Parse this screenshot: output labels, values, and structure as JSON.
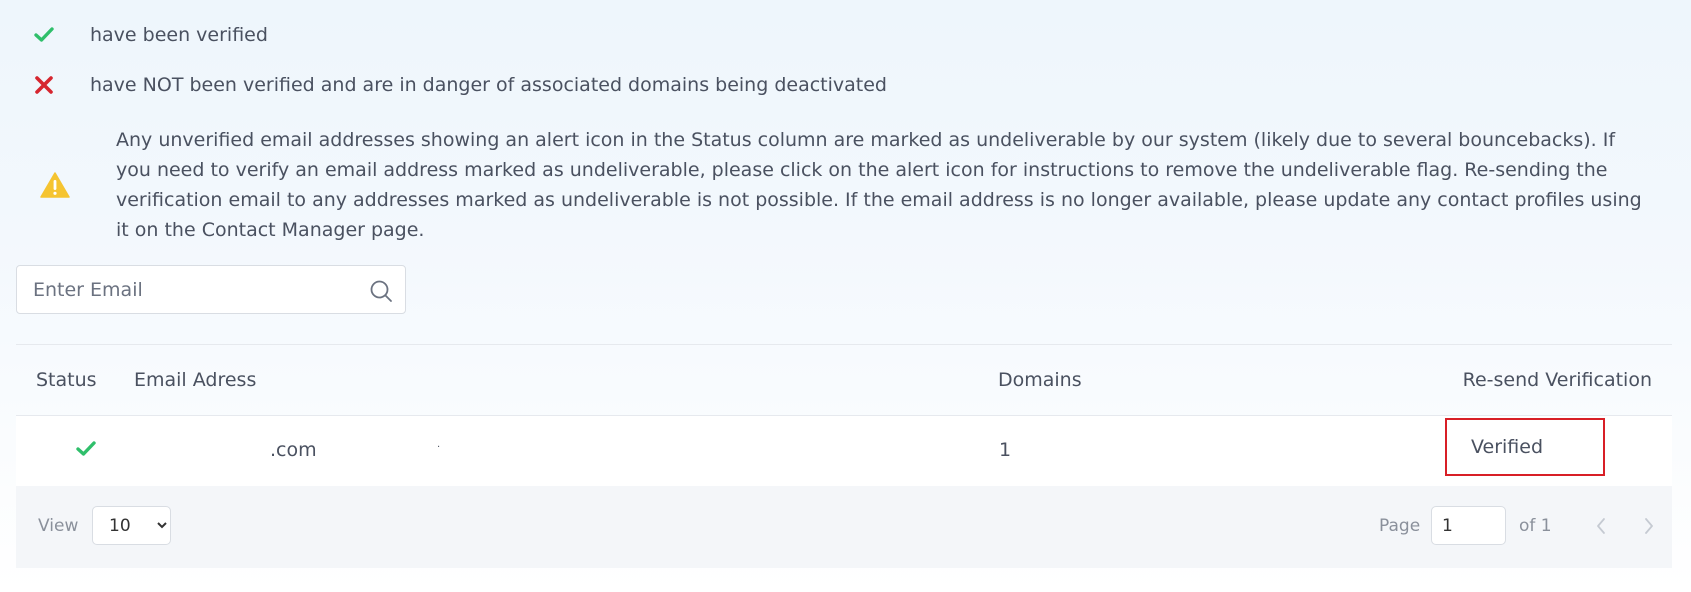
{
  "legend": {
    "verified_text": "have been verified",
    "not_verified_text": "have NOT been verified and are in danger of associated domains being deactivated",
    "warning_text": "Any unverified email addresses showing an alert icon in the Status column are marked as undeliverable by our system (likely due to several bouncebacks). If you need to verify an email address marked as undeliverable, please click on the alert icon for instructions to remove the undeliverable flag. Re-sending the verification email to any addresses marked as undeliverable is not possible. If the email address is no longer available, please update any contact profiles using it on the Contact Manager page."
  },
  "search": {
    "placeholder": "Enter Email",
    "value": ""
  },
  "table": {
    "headers": {
      "status": "Status",
      "email": "Email Adress",
      "domains": "Domains",
      "resend": "Re-send Verification"
    },
    "rows": [
      {
        "status": "verified",
        "email_visible": ".com",
        "email_dot": ".",
        "domains": "1",
        "resend": "Verified"
      }
    ]
  },
  "pagination": {
    "view_label": "View",
    "page_size": "10",
    "page_size_options": [
      "10"
    ],
    "page_label": "Page",
    "current_page": "1",
    "of_label": "of 1"
  },
  "colors": {
    "check_green": "#2fbf6b",
    "cross_red": "#d6262f",
    "warning_yellow": "#f5c431",
    "highlight_red": "#d81f26"
  },
  "icons": [
    "check-icon",
    "cross-icon",
    "warning-icon",
    "search-icon",
    "chevron-left-icon",
    "chevron-right-icon",
    "chevron-down-icon"
  ]
}
